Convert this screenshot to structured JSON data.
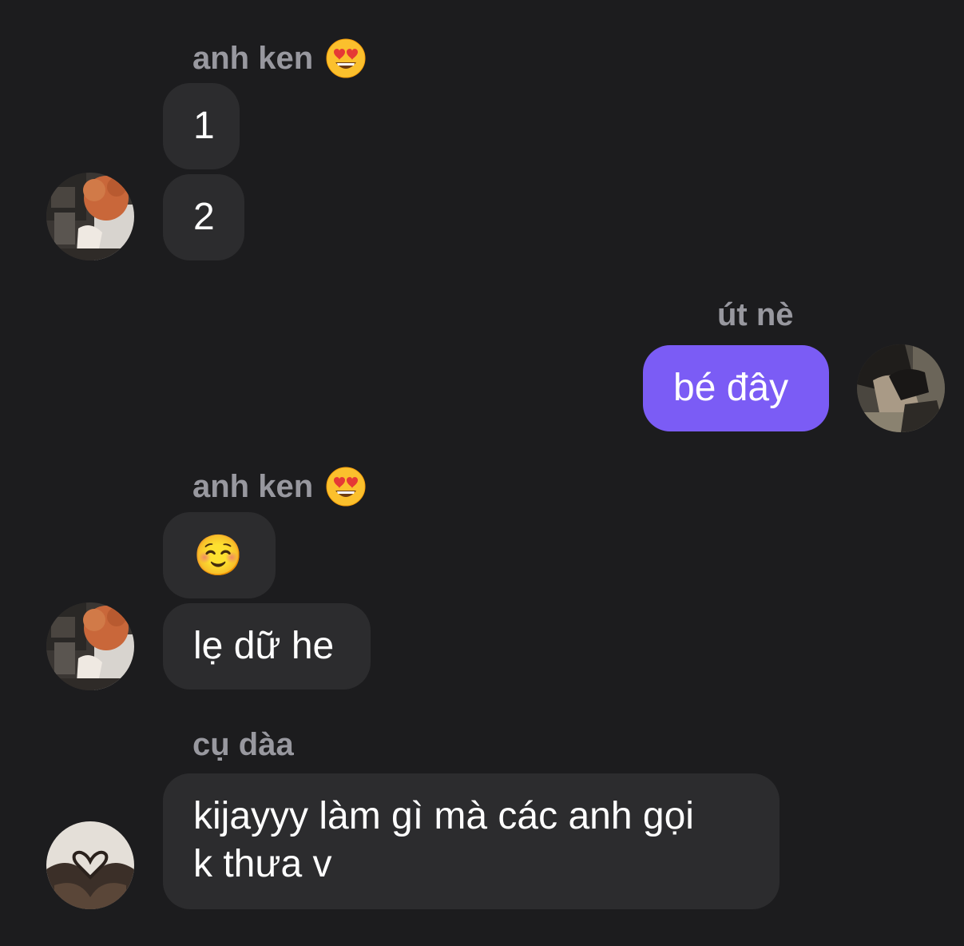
{
  "conversation": {
    "messages": [
      {
        "sender": "anh ken",
        "sender_emoji": "smiling-face-with-heart-eyes",
        "bubbles": [
          "1",
          "2"
        ]
      },
      {
        "sender": "út nè",
        "bubbles": [
          "bé đây"
        ],
        "outgoing": true
      },
      {
        "sender": "anh ken",
        "sender_emoji": "smiling-face-with-heart-eyes",
        "bubbles": [
          "☺️",
          "lẹ dữ he"
        ]
      },
      {
        "sender": "cụ dàa",
        "bubbles": [
          "kijayyy làm gì mà các anh gọi",
          "k thưa v"
        ]
      }
    ]
  },
  "colors": {
    "background": "#1c1c1e",
    "incoming_bubble": "#2c2c2e",
    "outgoing_bubble": "#7b5cf5",
    "sender_name": "#98989f"
  }
}
